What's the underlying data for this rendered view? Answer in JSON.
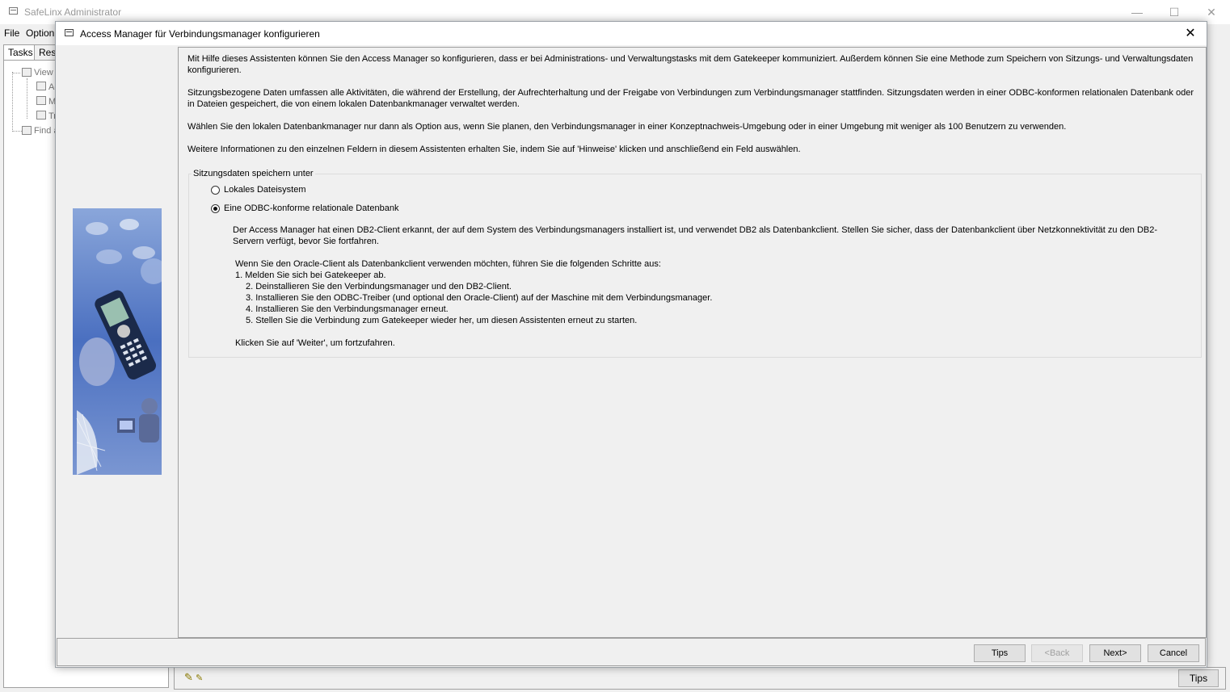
{
  "main_window": {
    "title": "SafeLinx Administrator",
    "menu": [
      "File",
      "Option"
    ],
    "tabs": [
      "Tasks",
      "Reso"
    ],
    "tree": [
      "View S",
      "Ac",
      "M",
      "Tr",
      "Find a"
    ],
    "status_tips_label": "Tips",
    "controls": {
      "minimize": "—",
      "maximize": "☐",
      "close": "✕"
    }
  },
  "dialog": {
    "title": "Access Manager für Verbindungsmanager konfigurieren",
    "close_glyph": "✕",
    "intro": [
      "Mit Hilfe dieses Assistenten können Sie den Access Manager so konfigurieren, dass er bei Administrations- und Verwaltungstasks mit dem Gatekeeper kommuniziert. Außerdem können Sie eine Methode zum Speichern von Sitzungs- und Verwaltungsdaten konfigurieren.",
      "Sitzungsbezogene Daten umfassen alle Aktivitäten, die während der Erstellung, der Aufrechterhaltung und der Freigabe von Verbindungen zum Verbindungsmanager stattfinden. Sitzungsdaten werden in einer ODBC-konformen relationalen Datenbank oder in Dateien gespeichert, die von einem lokalen Datenbankmanager verwaltet werden.",
      "Wählen Sie den lokalen Datenbankmanager nur dann als Option aus, wenn Sie planen, den Verbindungsmanager in einer Konzeptnachweis-Umgebung oder in einer Umgebung mit weniger als 100 Benutzern zu verwenden.",
      "Weitere Informationen zu den einzelnen Feldern in diesem Assistenten erhalten Sie, indem Sie auf 'Hinweise' klicken und anschließend ein Feld auswählen."
    ],
    "group": {
      "legend": "Sitzungsdaten speichern unter",
      "option_local": "Lokales Dateisystem",
      "option_odbc": "Eine ODBC-konforme relationale Datenbank",
      "selected": "odbc",
      "db2_notice": "Der Access Manager hat einen DB2-Client erkannt, der auf dem System des Verbindungsmanagers installiert ist, und verwendet DB2 als Datenbankclient. Stellen Sie sicher, dass der Datenbankclient über Netzkonnektivität zu den DB2-Servern verfügt, bevor Sie fortfahren.",
      "oracle_intro": "Wenn Sie den Oracle-Client als Datenbankclient verwenden möchten, führen Sie die folgenden Schritte aus:",
      "steps": [
        " 1. Melden Sie sich bei Gatekeeper ab.",
        "2. Deinstallieren Sie den Verbindungsmanager und den DB2-Client.",
        "3. Installieren Sie den ODBC-Treiber (und optional den Oracle-Client) auf der Maschine mit dem Verbindungsmanager.",
        "4. Installieren Sie den Verbindungsmanager erneut.",
        "5. Stellen Sie die Verbindung zum Gatekeeper wieder her, um diesen Assistenten erneut zu starten."
      ],
      "continue_text": "Klicken Sie auf 'Weiter', um fortzufahren."
    },
    "buttons": {
      "tips": "Tips",
      "back": "<Back",
      "next": "Next>",
      "cancel": "Cancel"
    }
  }
}
